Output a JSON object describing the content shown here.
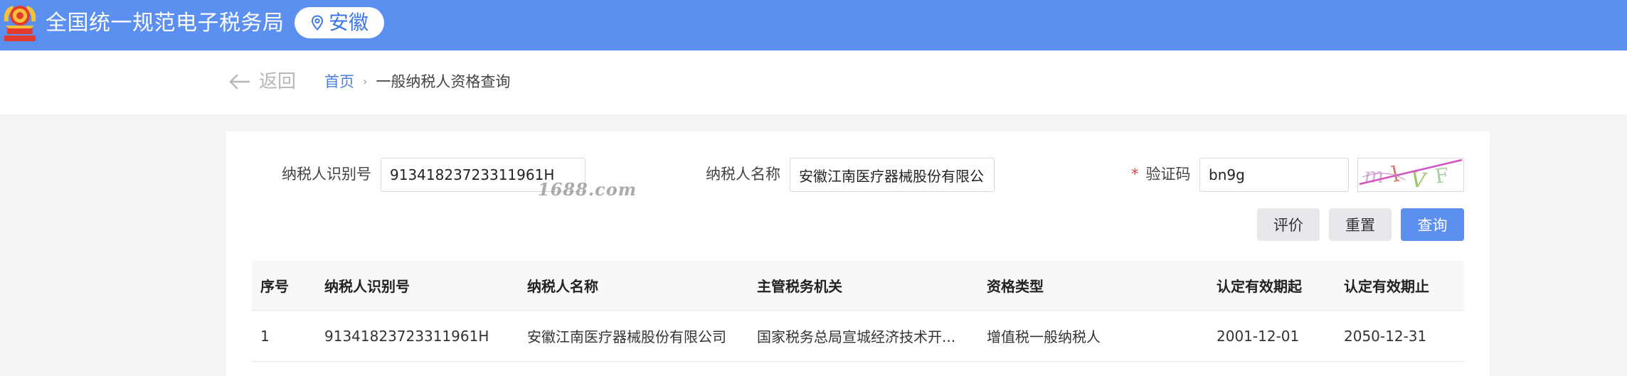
{
  "header": {
    "site_title": "全国统一规范电子税务局",
    "region": "安徽",
    "colors": {
      "bar": "#5b8ff0",
      "accent": "#3f76e6"
    }
  },
  "nav": {
    "back_label": "返回",
    "breadcrumb": {
      "home": "首页",
      "separator": "›",
      "current": "一般纳税人资格查询"
    }
  },
  "form": {
    "taxpayer_id": {
      "label": "纳税人识别号",
      "value": "91341823723311961H"
    },
    "taxpayer_name": {
      "label": "纳税人名称",
      "value": "安徽江南医疗器械股份有限公司"
    },
    "captcha": {
      "required_mark": "*",
      "label": "验证码",
      "value": "bn9g",
      "image_text": "mlVF"
    },
    "buttons": {
      "rate": "评价",
      "reset": "重置",
      "query": "查询"
    }
  },
  "watermark": "1688.com",
  "table": {
    "columns": [
      "序号",
      "纳税人识别号",
      "纳税人名称",
      "主管税务机关",
      "资格类型",
      "认定有效期起",
      "认定有效期止"
    ],
    "rows": [
      [
        "1",
        "91341823723311961H",
        "安徽江南医疗器械股份有限公司",
        "国家税务总局宣城经济技术开...",
        "增值税一般纳税人",
        "2001-12-01",
        "2050-12-31"
      ]
    ]
  }
}
